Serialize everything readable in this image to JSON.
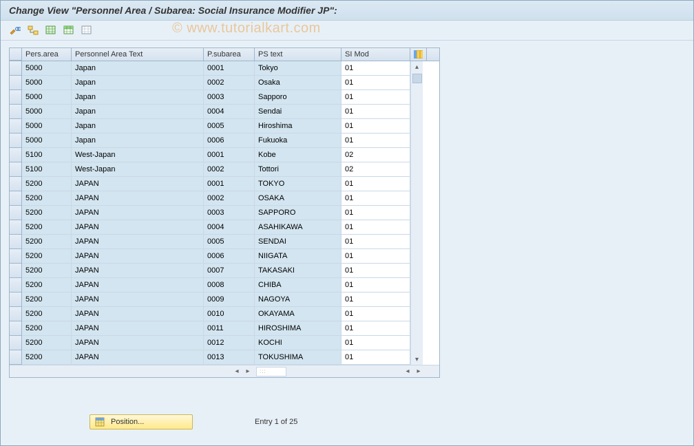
{
  "title": "Change View \"Personnel Area / Subarea: Social Insurance Modifier JP\":",
  "watermark": "© www.tutorialkart.com",
  "toolbar": {
    "btn1": "detail-toggle",
    "btn2": "select-all",
    "btn3": "deselect-all",
    "btn4": "copy-as",
    "btn5": "print"
  },
  "columns": {
    "pa": "Pers.area",
    "pat": "Personnel Area Text",
    "ps": "P.subarea",
    "pst": "PS text",
    "si": "SI Mod"
  },
  "rows": [
    {
      "pa": "5000",
      "pat": "Japan",
      "ps": "0001",
      "pst": "Tokyo",
      "si": "01"
    },
    {
      "pa": "5000",
      "pat": "Japan",
      "ps": "0002",
      "pst": "Osaka",
      "si": "01"
    },
    {
      "pa": "5000",
      "pat": "Japan",
      "ps": "0003",
      "pst": "Sapporo",
      "si": "01"
    },
    {
      "pa": "5000",
      "pat": "Japan",
      "ps": "0004",
      "pst": "Sendai",
      "si": "01"
    },
    {
      "pa": "5000",
      "pat": "Japan",
      "ps": "0005",
      "pst": "Hiroshima",
      "si": "01"
    },
    {
      "pa": "5000",
      "pat": "Japan",
      "ps": "0006",
      "pst": "Fukuoka",
      "si": "01"
    },
    {
      "pa": "5100",
      "pat": "West-Japan",
      "ps": "0001",
      "pst": "Kobe",
      "si": "02"
    },
    {
      "pa": "5100",
      "pat": "West-Japan",
      "ps": "0002",
      "pst": "Tottori",
      "si": "02"
    },
    {
      "pa": "5200",
      "pat": "JAPAN",
      "ps": "0001",
      "pst": "TOKYO",
      "si": "01"
    },
    {
      "pa": "5200",
      "pat": "JAPAN",
      "ps": "0002",
      "pst": "OSAKA",
      "si": "01"
    },
    {
      "pa": "5200",
      "pat": "JAPAN",
      "ps": "0003",
      "pst": "SAPPORO",
      "si": "01"
    },
    {
      "pa": "5200",
      "pat": "JAPAN",
      "ps": "0004",
      "pst": "ASAHIKAWA",
      "si": "01"
    },
    {
      "pa": "5200",
      "pat": "JAPAN",
      "ps": "0005",
      "pst": "SENDAI",
      "si": "01"
    },
    {
      "pa": "5200",
      "pat": "JAPAN",
      "ps": "0006",
      "pst": "NIIGATA",
      "si": "01"
    },
    {
      "pa": "5200",
      "pat": "JAPAN",
      "ps": "0007",
      "pst": "TAKASAKI",
      "si": "01"
    },
    {
      "pa": "5200",
      "pat": "JAPAN",
      "ps": "0008",
      "pst": "CHIBA",
      "si": "01"
    },
    {
      "pa": "5200",
      "pat": "JAPAN",
      "ps": "0009",
      "pst": "NAGOYA",
      "si": "01"
    },
    {
      "pa": "5200",
      "pat": "JAPAN",
      "ps": "0010",
      "pst": "OKAYAMA",
      "si": "01"
    },
    {
      "pa": "5200",
      "pat": "JAPAN",
      "ps": "0011",
      "pst": "HIROSHIMA",
      "si": "01"
    },
    {
      "pa": "5200",
      "pat": "JAPAN",
      "ps": "0012",
      "pst": "KOCHI",
      "si": "01"
    },
    {
      "pa": "5200",
      "pat": "JAPAN",
      "ps": "0013",
      "pst": "TOKUSHIMA",
      "si": "01"
    }
  ],
  "footer": {
    "position_label": "Position...",
    "entry_text": "Entry 1 of 25"
  }
}
